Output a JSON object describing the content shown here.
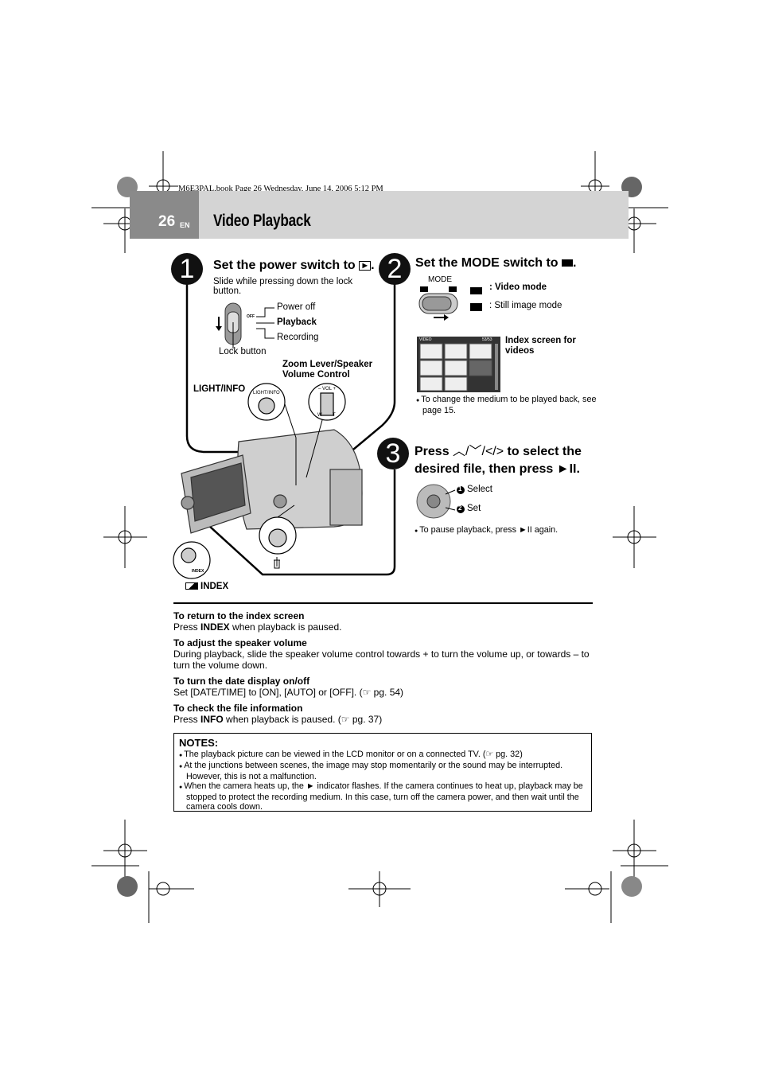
{
  "print_meta": "M6E3PAL.book  Page 26  Wednesday, June 14, 2006  5:12 PM",
  "header": {
    "page_number": "26",
    "lang": "EN",
    "title": "Video Playback"
  },
  "step1": {
    "number": "1",
    "heading": "Set the power switch to",
    "heading_icon": "playback-icon",
    "desc": "Slide while pressing down the lock button.",
    "switch_labels": [
      "Power off",
      "Playback",
      "Recording"
    ],
    "switch_marks": [
      "OFF"
    ],
    "lock_button": "Lock button",
    "zoom_lever": "Zoom Lever/Speaker Volume Control",
    "light_info": "LIGHT/INFO",
    "light_info_btn": "LIGHT/INFO",
    "vol_marks": [
      "– VOL +",
      "W",
      "T"
    ],
    "index_small": "INDEX",
    "index_label": "INDEX"
  },
  "step2": {
    "number": "2",
    "heading": "Set the MODE switch to",
    "heading_icon": "video-camera-icon",
    "mode_label": "MODE",
    "video_mode": ": Video mode",
    "still_mode": ": Still image mode",
    "index_screen": "Index screen for videos",
    "index_screen_header_left": "VIDEO",
    "index_screen_header_right": "53/53",
    "note": "To change the medium to be played back, see page 15."
  },
  "step3": {
    "number": "3",
    "heading_press": "Press",
    "heading_rest": "to select the",
    "heading_line2": "desired file, then press ►II.",
    "select_num": "1",
    "select": "Select",
    "set_num": "2",
    "set": "Set",
    "note": "To pause playback, press ►II again."
  },
  "sections": [
    {
      "title": "To return to the index screen",
      "pre": "Press ",
      "bold": "INDEX",
      "post": " when playback is paused."
    },
    {
      "title": "To adjust the speaker volume",
      "pre": "During playback, slide the speaker volume control towards + to turn the volume up, or towards – to turn the volume down.",
      "bold": "",
      "post": ""
    },
    {
      "title": "To turn the date display on/off",
      "pre": "Set [DATE/TIME] to [ON], [AUTO] or [OFF]. (☞ pg. 54)",
      "bold": "",
      "post": ""
    },
    {
      "title": "To check the file information",
      "pre": "Press ",
      "bold": "INFO",
      "post": " when playback is paused. (☞ pg. 37)"
    }
  ],
  "notes": {
    "title": "NOTES:",
    "items": [
      "The playback picture can be viewed in the LCD monitor or on a connected TV. (☞ pg. 32)",
      "At the junctions between scenes, the image may stop momentarily or the sound may be interrupted. However, this is not a malfunction.",
      "When the camera heats up, the ► indicator flashes. If the camera continues to heat up, playback may be stopped to protect the recording medium. In this case, turn off the camera power, and then wait until the camera cools down."
    ]
  },
  "colors": {
    "header_band": "#d4d4d4",
    "page_block": "#8a8a8a",
    "text": "#000000"
  }
}
